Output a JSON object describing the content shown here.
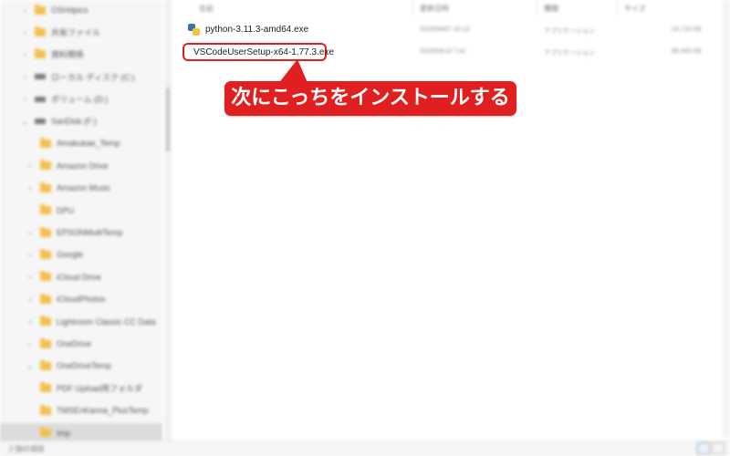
{
  "sidebar": {
    "items": [
      {
        "label": "OSHdpics",
        "type": "folder",
        "chev": "›"
      },
      {
        "label": "共有ファイル",
        "type": "folder",
        "chev": "›"
      },
      {
        "label": "資料関係",
        "type": "folder",
        "chev": "›"
      },
      {
        "label": "ローカル ディスク (C:)",
        "type": "drive",
        "chev": "›"
      },
      {
        "label": "ボリューム (D:)",
        "type": "drive",
        "chev": "›"
      },
      {
        "label": "SanDisk (F:)",
        "type": "drive",
        "chev": "⌄"
      },
      {
        "label": "Amakukae_Temp",
        "type": "folder",
        "chev": ""
      },
      {
        "label": "Amazon Drive",
        "type": "folder",
        "chev": "›"
      },
      {
        "label": "Amazon Music",
        "type": "folder",
        "chev": "›"
      },
      {
        "label": "DPU",
        "type": "folder",
        "chev": ""
      },
      {
        "label": "EPSONMultiTemp",
        "type": "folder",
        "chev": "›"
      },
      {
        "label": "Google",
        "type": "folder",
        "chev": "›"
      },
      {
        "label": "iCloud Drive",
        "type": "folder",
        "chev": "›"
      },
      {
        "label": "iCloudPhotos",
        "type": "folder",
        "chev": "›"
      },
      {
        "label": "Lightroom Classic CC Data",
        "type": "folder",
        "chev": "›"
      },
      {
        "label": "OneDrive",
        "type": "folder",
        "chev": "›"
      },
      {
        "label": "OneDriveTemp",
        "type": "folder",
        "chev": "⌄"
      },
      {
        "label": "PDF Upload用フォルダ",
        "type": "folder",
        "chev": ""
      },
      {
        "label": "TMSEnKanna_PlusTemp",
        "type": "folder",
        "chev": ""
      },
      {
        "label": "tmp",
        "type": "folder",
        "chev": "",
        "selected": true
      }
    ]
  },
  "columns": {
    "name": "名前",
    "date": "更新日時",
    "type": "種類",
    "size": "サイズ"
  },
  "files": [
    {
      "name": "python-3.11.3-amd64.exe",
      "date": "2023/04/07 10:13",
      "type": "アプリケーション",
      "size": "24,716 KB"
    },
    {
      "name": "VSCodeUserSetup-x64-1.77.3.exe",
      "date": "2023/04/13 7:41",
      "type": "アプリケーション",
      "size": "86,440 KB"
    }
  ],
  "callout": {
    "text": "次にこっちをインストールする"
  },
  "status": {
    "items_text": "2 個の項目"
  }
}
